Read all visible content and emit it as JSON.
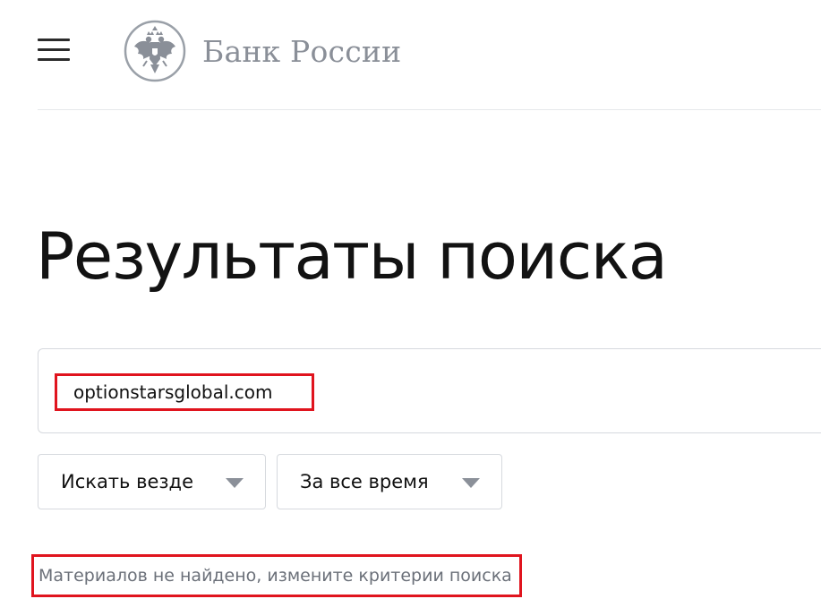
{
  "header": {
    "menu_icon": "hamburger-icon",
    "logo_icon": "double-headed-eagle-emblem",
    "logo_text": "Банк России"
  },
  "main": {
    "title": "Результаты поиска",
    "search": {
      "value": "optionstarsglobal.com",
      "placeholder": ""
    },
    "filters": [
      {
        "selected": "Искать везде",
        "icon": "chevron-down-icon"
      },
      {
        "selected": "За все время",
        "icon": "chevron-down-icon"
      }
    ],
    "status": "Материалов не найдено, измените критерии поиска"
  },
  "colors": {
    "highlight": "#e0141e",
    "logo": "#8a8f98",
    "muted_text": "#6b7079"
  }
}
